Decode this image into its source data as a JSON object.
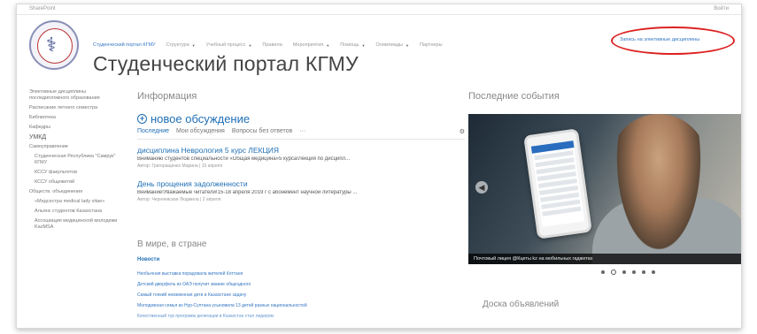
{
  "suitebar": {
    "left": "SharePoint",
    "right": "Войти"
  },
  "site": {
    "title": "Студенческий портал КГМУ"
  },
  "topnav": {
    "items": [
      {
        "label": "Студенческий портал КГМУ",
        "caret": false
      },
      {
        "label": "Структура",
        "caret": true
      },
      {
        "label": "Учебный процесс",
        "caret": true
      },
      {
        "label": "Правила",
        "caret": false
      },
      {
        "label": "Мероприятия",
        "caret": true
      },
      {
        "label": "Помощь",
        "caret": true
      },
      {
        "label": "Олимпиады",
        "caret": true
      },
      {
        "label": "Партнеры",
        "caret": false
      }
    ],
    "highlighted": "Запись на элективные дисциплины"
  },
  "leftnav": [
    {
      "label": "Элективные дисциплины последипломного образования",
      "style": "normal"
    },
    {
      "label": "Расписание летнего семестра",
      "style": "normal"
    },
    {
      "label": "Библиотека",
      "style": "normal"
    },
    {
      "label": "Кафедры",
      "style": "normal"
    },
    {
      "label": "УМКД",
      "style": "big"
    },
    {
      "label": "Самоуправление",
      "style": "normal"
    },
    {
      "label": "Студенческая Республика \"Самрук\" КГМУ",
      "style": "sub"
    },
    {
      "label": "КССУ факультетов",
      "style": "sub"
    },
    {
      "label": "КССУ общежитий",
      "style": "sub"
    },
    {
      "label": "Обществ. объединения",
      "style": "normal"
    },
    {
      "label": "«Медсестра medical lady vitae»",
      "style": "sub"
    },
    {
      "label": "Альянс студентов Казахстана",
      "style": "sub"
    },
    {
      "label": "Ассоциация медицинской молодежи KazMSA",
      "style": "sub"
    }
  ],
  "info": {
    "heading": "Информация",
    "new_discussion": "новое обсуждение",
    "tabs": [
      "Последние",
      "Мои обсуждения",
      "Вопросы без ответов",
      "···"
    ],
    "posts": [
      {
        "title": "дисциплина Неврология 5 курс ЛЕКЦИЯ",
        "body": "Вниманию студентов специальности «Общая медицина»5 курса!Лекция по дисципл...",
        "meta": "Автор: Григоращенко Марина  |  15 апреля"
      },
      {
        "title": "День прощения задолженности",
        "body": "Внимание!Уважаемые читатели!15-18 апреля 2019 г с абонемент научной литературы ...",
        "meta": "Автор: Черняевская Людмила  |  2 апреля"
      }
    ]
  },
  "world": {
    "heading": "В мире, в стране",
    "news_heading": "Новости",
    "news": [
      "Необычная выставка порадовала жителей Коттаня",
      "Детский дворфель из ОАЭ получит звание общеэдного",
      "Самый тонкий неизменная дети в Казахстане задачу",
      "Молодежная семья из Нур-Султана усыновила 13 детей разных национальностей",
      "Качественный тур программ делегации в Казахстан стал лидером"
    ]
  },
  "events": {
    "heading": "Последние события",
    "caption": "Почтовый лицея @Кцеты kz на мобильных гаджетах",
    "carousel_count": 6,
    "carousel_active": 1
  },
  "board": {
    "heading": "Доска объявлений"
  },
  "colors": {
    "link": "#1f6fb5",
    "annotation": "#dd2222"
  }
}
